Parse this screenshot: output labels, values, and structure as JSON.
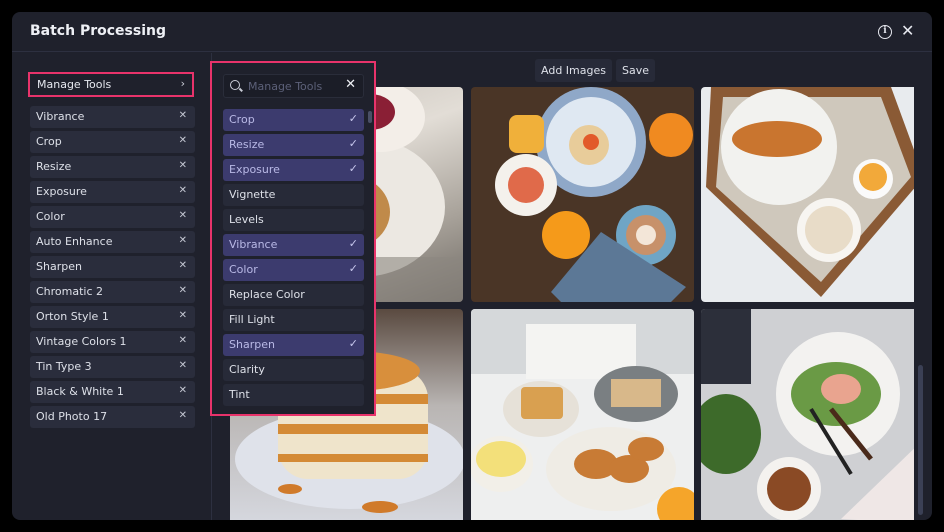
{
  "window": {
    "title": "Batch Processing",
    "info_icon": "info-circle-icon",
    "close_icon": "close-x-icon",
    "close_glyph": "✕",
    "info_glyph": "i"
  },
  "left_panel": {
    "manage_tools_label": "Manage Tools",
    "manage_tools_chevron": "›",
    "remove_glyph": "✕",
    "applied_tools": [
      "Vibrance",
      "Crop",
      "Resize",
      "Exposure",
      "Color",
      "Auto Enhance",
      "Sharpen",
      "Chromatic 2",
      "Orton Style 1",
      "Vintage Colors 1",
      "Tin Type 3",
      "Black & White 1",
      "Old Photo 17"
    ]
  },
  "toolbar": {
    "add_images_label": "Add Images",
    "save_label": "Save"
  },
  "dropdown": {
    "search_placeholder": "Manage Tools",
    "search_value": "",
    "clear_glyph": "✕",
    "check_glyph": "✓",
    "items": [
      {
        "label": "Crop",
        "selected": true
      },
      {
        "label": "Resize",
        "selected": true
      },
      {
        "label": "Exposure",
        "selected": true
      },
      {
        "label": "Vignette",
        "selected": false
      },
      {
        "label": "Levels",
        "selected": false
      },
      {
        "label": "Vibrance",
        "selected": true
      },
      {
        "label": "Color",
        "selected": true
      },
      {
        "label": "Replace Color",
        "selected": false
      },
      {
        "label": "Fill Light",
        "selected": false
      },
      {
        "label": "Sharpen",
        "selected": true
      },
      {
        "label": "Clarity",
        "selected": false
      },
      {
        "label": "Tint",
        "selected": false
      }
    ]
  },
  "gallery": {
    "images": [
      {
        "name": "dessert-plate-with-tea",
        "description": "dessert on white plate with tea cup"
      },
      {
        "name": "breakfast-table-top-view",
        "description": "breakfast spread on wooden table with latte"
      },
      {
        "name": "croissant-tray",
        "description": "croissant and orange juice on wooden tray"
      },
      {
        "name": "pancake-stack",
        "description": "pancake stack with caramel sauce"
      },
      {
        "name": "waffles-and-croissants",
        "description": "waffles, croissants and toast on white table"
      },
      {
        "name": "salad-and-coffee",
        "description": "salad plate and coffee on marble"
      }
    ]
  },
  "colors": {
    "highlight": "#e8336b",
    "selected_item": "#3c3b6e",
    "background": "#1f212c"
  }
}
